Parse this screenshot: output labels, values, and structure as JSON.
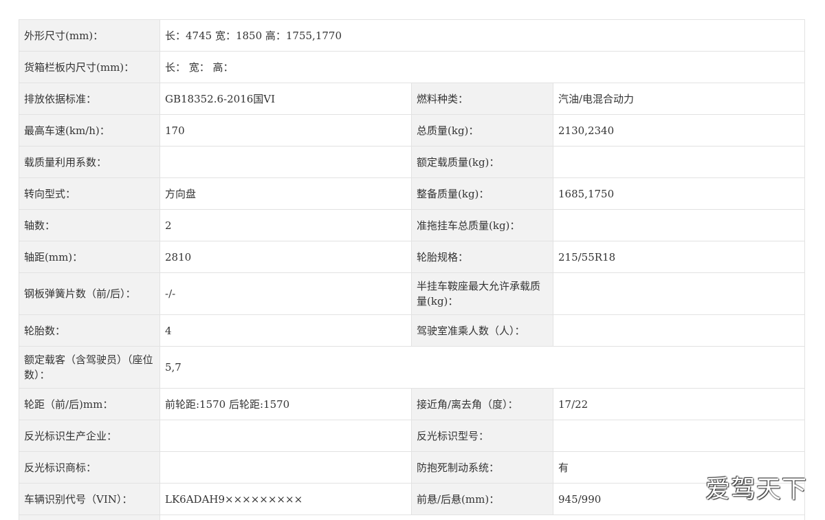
{
  "rows": [
    {
      "l1": "外形尺寸(mm)：",
      "v1": "长：4745 宽：1850 高：1755,1770"
    },
    {
      "l1": "货箱栏板内尺寸(mm)：",
      "v1": "长： 宽： 高："
    },
    {
      "l1": "排放依据标准：",
      "v1": "GB18352.6-2016国VI",
      "l2": "燃料种类：",
      "v2": "汽油/电混合动力"
    },
    {
      "l1": "最高车速(km/h)：",
      "v1": "170",
      "l2": "总质量(kg)：",
      "v2": "2130,2340"
    },
    {
      "l1": "载质量利用系数：",
      "v1": "",
      "l2": "额定载质量(kg)：",
      "v2": ""
    },
    {
      "l1": "转向型式：",
      "v1": "方向盘",
      "l2": "整备质量(kg)：",
      "v2": "1685,1750"
    },
    {
      "l1": "轴数：",
      "v1": "2",
      "l2": "准拖挂车总质量(kg)：",
      "v2": ""
    },
    {
      "l1": "轴距(mm)：",
      "v1": "2810",
      "l2": "轮胎规格：",
      "v2": "215/55R18"
    },
    {
      "l1": "钢板弹簧片数（前/后）：",
      "v1": "-/-",
      "l2": "半挂车鞍座最大允许承载质量(kg)：",
      "v2": ""
    },
    {
      "l1": "轮胎数：",
      "v1": "4",
      "l2": "驾驶室准乘人数（人）：",
      "v2": ""
    },
    {
      "l1": "额定载客（含驾驶员）（座位数）：",
      "v1": "5,7"
    },
    {
      "l1": "轮距（前/后)mm：",
      "v1": "前轮距:1570 后轮距:1570",
      "l2": "接近角/离去角（度）：",
      "v2": "17/22"
    },
    {
      "l1": "反光标识生产企业：",
      "v1": "",
      "l2": "反光标识型号：",
      "v2": ""
    },
    {
      "l1": "反光标识商标：",
      "v1": "",
      "l2": "防抱死制动系统：",
      "v2": "有"
    },
    {
      "l1": "车辆识别代号（VIN）：",
      "v1": "LK6ADAH9×××××××××",
      "l2": "前悬/后悬(mm)：",
      "v2": "945/990"
    }
  ],
  "watermark": "爱驾天下"
}
